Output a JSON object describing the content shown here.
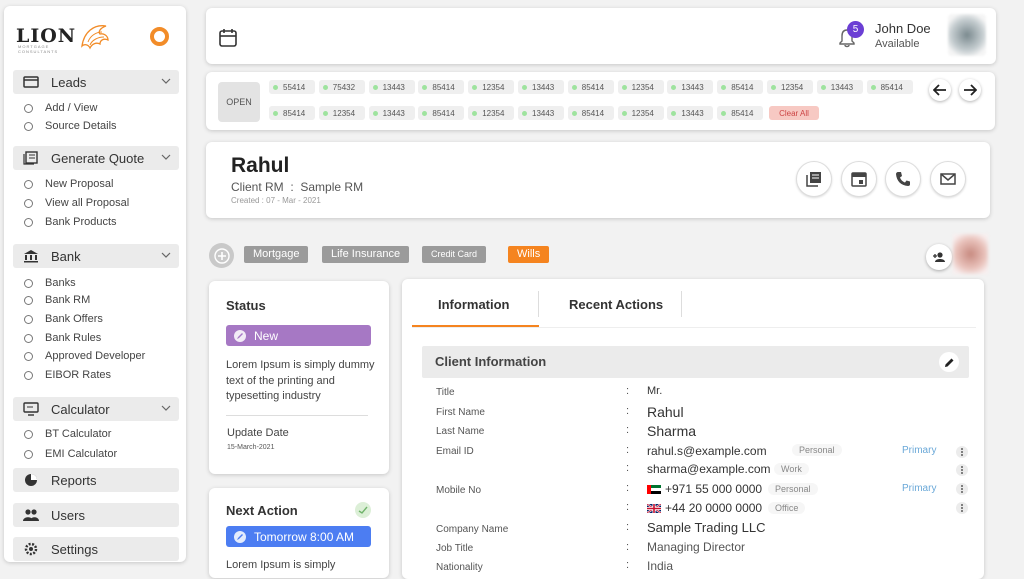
{
  "logo": {
    "name": "LION",
    "sub": "MORTGAGE CONSULTANTS"
  },
  "sidebar": {
    "sections": [
      {
        "label": "Leads",
        "icon": "card-icon",
        "items": [
          "Add / View",
          "Source Details"
        ]
      },
      {
        "label": "Generate Quote",
        "icon": "document-icon",
        "items": [
          "New Proposal",
          "View all Proposal",
          "Bank Products"
        ]
      },
      {
        "label": "Bank",
        "icon": "bank-icon",
        "items": [
          "Banks",
          "Bank RM",
          "Bank Offers",
          "Bank Rules",
          "Approved Developer",
          "EIBOR Rates"
        ]
      },
      {
        "label": "Calculator",
        "icon": "monitor-icon",
        "items": [
          "BT Calculator",
          "EMI Calculator"
        ]
      }
    ],
    "reports": "Reports",
    "users": "Users",
    "settings": "Settings"
  },
  "header": {
    "notifications": "5",
    "user_name": "John Doe",
    "user_status": "Available"
  },
  "strip": {
    "open_label": "OPEN",
    "row1": [
      "55414",
      "75432",
      "13443",
      "85414",
      "12354",
      "13443",
      "85414",
      "12354",
      "13443",
      "85414",
      "12354",
      "13443",
      "85414"
    ],
    "row2": [
      "85414",
      "12354",
      "13443",
      "85414",
      "12354",
      "13443",
      "85414",
      "12354",
      "13443",
      "85414"
    ],
    "clear_all": "Clear All"
  },
  "client": {
    "name": "Rahul",
    "rm_label": "Client RM",
    "rm_sep": ":",
    "rm_value": "Sample RM",
    "created": "Created : 07 - Mar - 2021"
  },
  "tags": [
    "Mortgage",
    "Life Insurance",
    "Credit Card",
    "Wills"
  ],
  "active_tag": "Wills",
  "status": {
    "title": "Status",
    "value": "New",
    "text": "Lorem Ipsum is simply dummy text of the printing and typesetting industry",
    "update_label": "Update Date",
    "update_value": "15-March-2021"
  },
  "next_action": {
    "title": "Next Action",
    "value": "Tomorrow 8:00 AM",
    "text": "Lorem Ipsum is simply"
  },
  "info": {
    "tabs": [
      "Information",
      "Recent Actions"
    ],
    "section_title": "Client Information",
    "fields": {
      "title": {
        "label": "Title",
        "value": "Mr."
      },
      "first_name": {
        "label": "First Name",
        "value": "Rahul"
      },
      "last_name": {
        "label": "Last Name",
        "value": "Sharma"
      },
      "email_label": "Email ID",
      "email1": "rahul.s@example.com",
      "email1_tag": "Personal",
      "email1_primary": "Primary",
      "email2": "sharma@example.com",
      "email2_tag": "Work",
      "mobile_label": "Mobile No",
      "mobile1": "+971 55 000 0000",
      "mobile1_tag": "Personal",
      "mobile1_primary": "Primary",
      "mobile2": "+44 20 0000 0000",
      "mobile2_tag": "Office",
      "company": {
        "label": "Company Name",
        "value": "Sample Trading LLC"
      },
      "job": {
        "label": "Job Title",
        "value": "Managing Director"
      },
      "nationality": {
        "label": "Nationality",
        "value": "India"
      }
    },
    "colon": ":"
  },
  "colors": {
    "accent": "#f5841f",
    "purple": "#a678c4",
    "blue": "#4c7df2",
    "badge": "#6b3fd4"
  }
}
